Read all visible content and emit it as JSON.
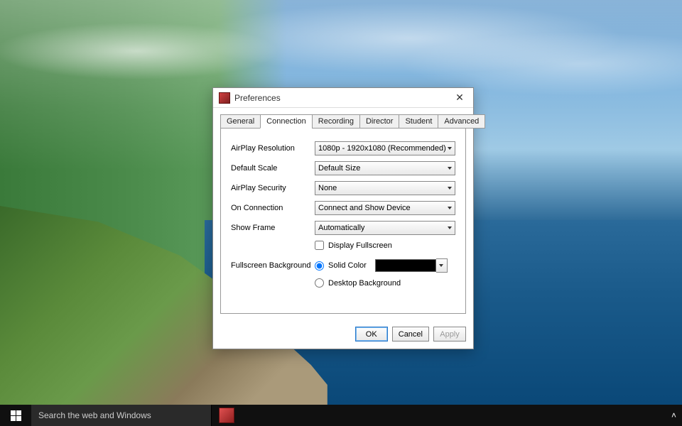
{
  "dialog": {
    "title": "Preferences",
    "tabs": [
      "General",
      "Connection",
      "Recording",
      "Director",
      "Student",
      "Advanced"
    ],
    "active_tab": "Connection",
    "fields": {
      "airplay_resolution": {
        "label": "AirPlay Resolution",
        "value": "1080p - 1920x1080 (Recommended)"
      },
      "default_scale": {
        "label": "Default Scale",
        "value": "Default Size"
      },
      "airplay_security": {
        "label": "AirPlay Security",
        "value": "None"
      },
      "on_connection": {
        "label": "On Connection",
        "value": "Connect and Show Device"
      },
      "show_frame": {
        "label": "Show Frame",
        "value": "Automatically"
      },
      "display_fullscreen": {
        "label": "Display Fullscreen",
        "checked": false
      },
      "fullscreen_background": {
        "label": "Fullscreen Background",
        "selected": "solid",
        "solid_label": "Solid Color",
        "solid_color": "#000000",
        "desktop_label": "Desktop Background"
      }
    },
    "buttons": {
      "ok": "OK",
      "cancel": "Cancel",
      "apply": "Apply"
    }
  },
  "taskbar": {
    "search_placeholder": "Search the web and Windows"
  }
}
